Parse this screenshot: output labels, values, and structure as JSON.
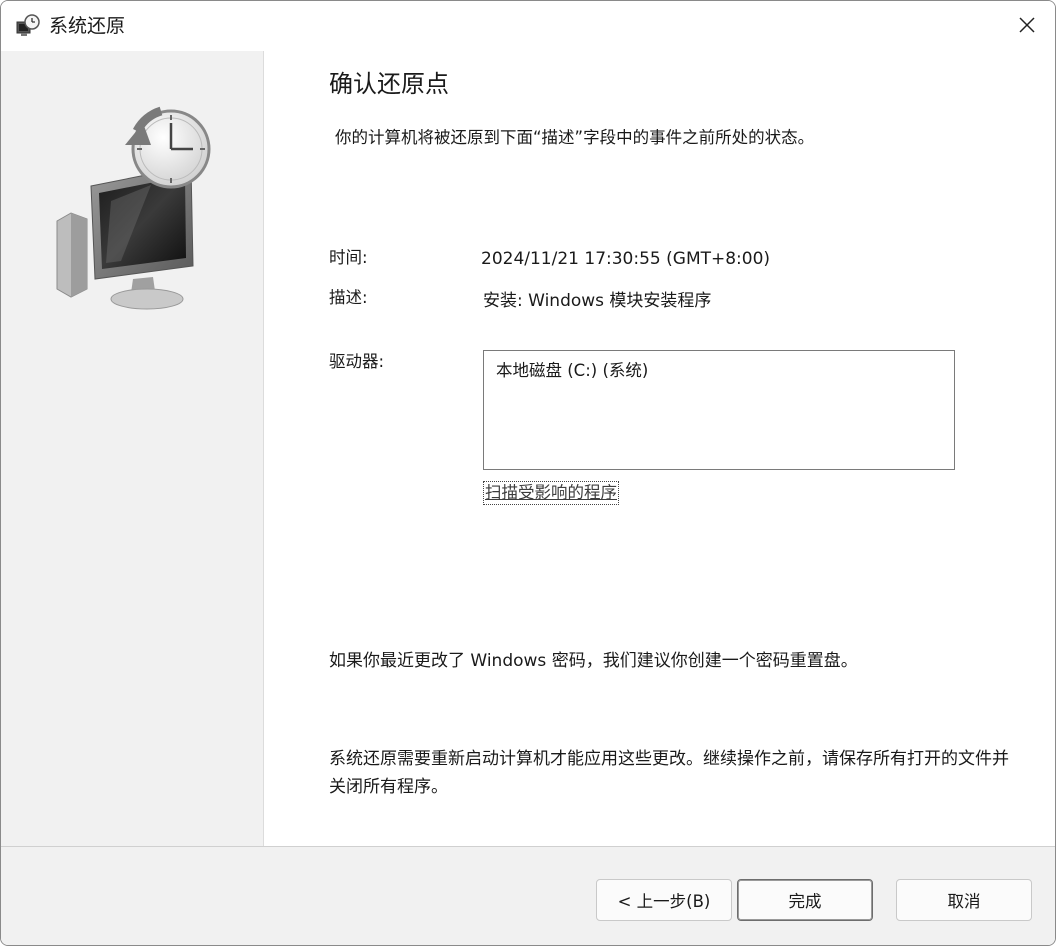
{
  "window": {
    "title": "系统还原"
  },
  "main": {
    "heading": "确认还原点",
    "description": "你的计算机将被还原到下面“描述”字段中的事件之前所处的状态。",
    "time_label": "时间:",
    "time_value": "2024/11/21 17:30:55 (GMT+8:00)",
    "desc_label": "描述:",
    "desc_value": "安装: Windows 模块安装程序",
    "drives_label": "驱动器:",
    "drives": [
      "本地磁盘 (C:) (系统)"
    ],
    "scan_link": "扫描受影响的程序",
    "password_note": "如果你最近更改了 Windows 密码，我们建议你创建一个密码重置盘。",
    "restart_note": "系统还原需要重新启动计算机才能应用这些更改。继续操作之前，请保存所有打开的文件并关闭所有程序。"
  },
  "footer": {
    "back_label": "< 上一步(B)",
    "finish_label": "完成",
    "cancel_label": "取消"
  }
}
